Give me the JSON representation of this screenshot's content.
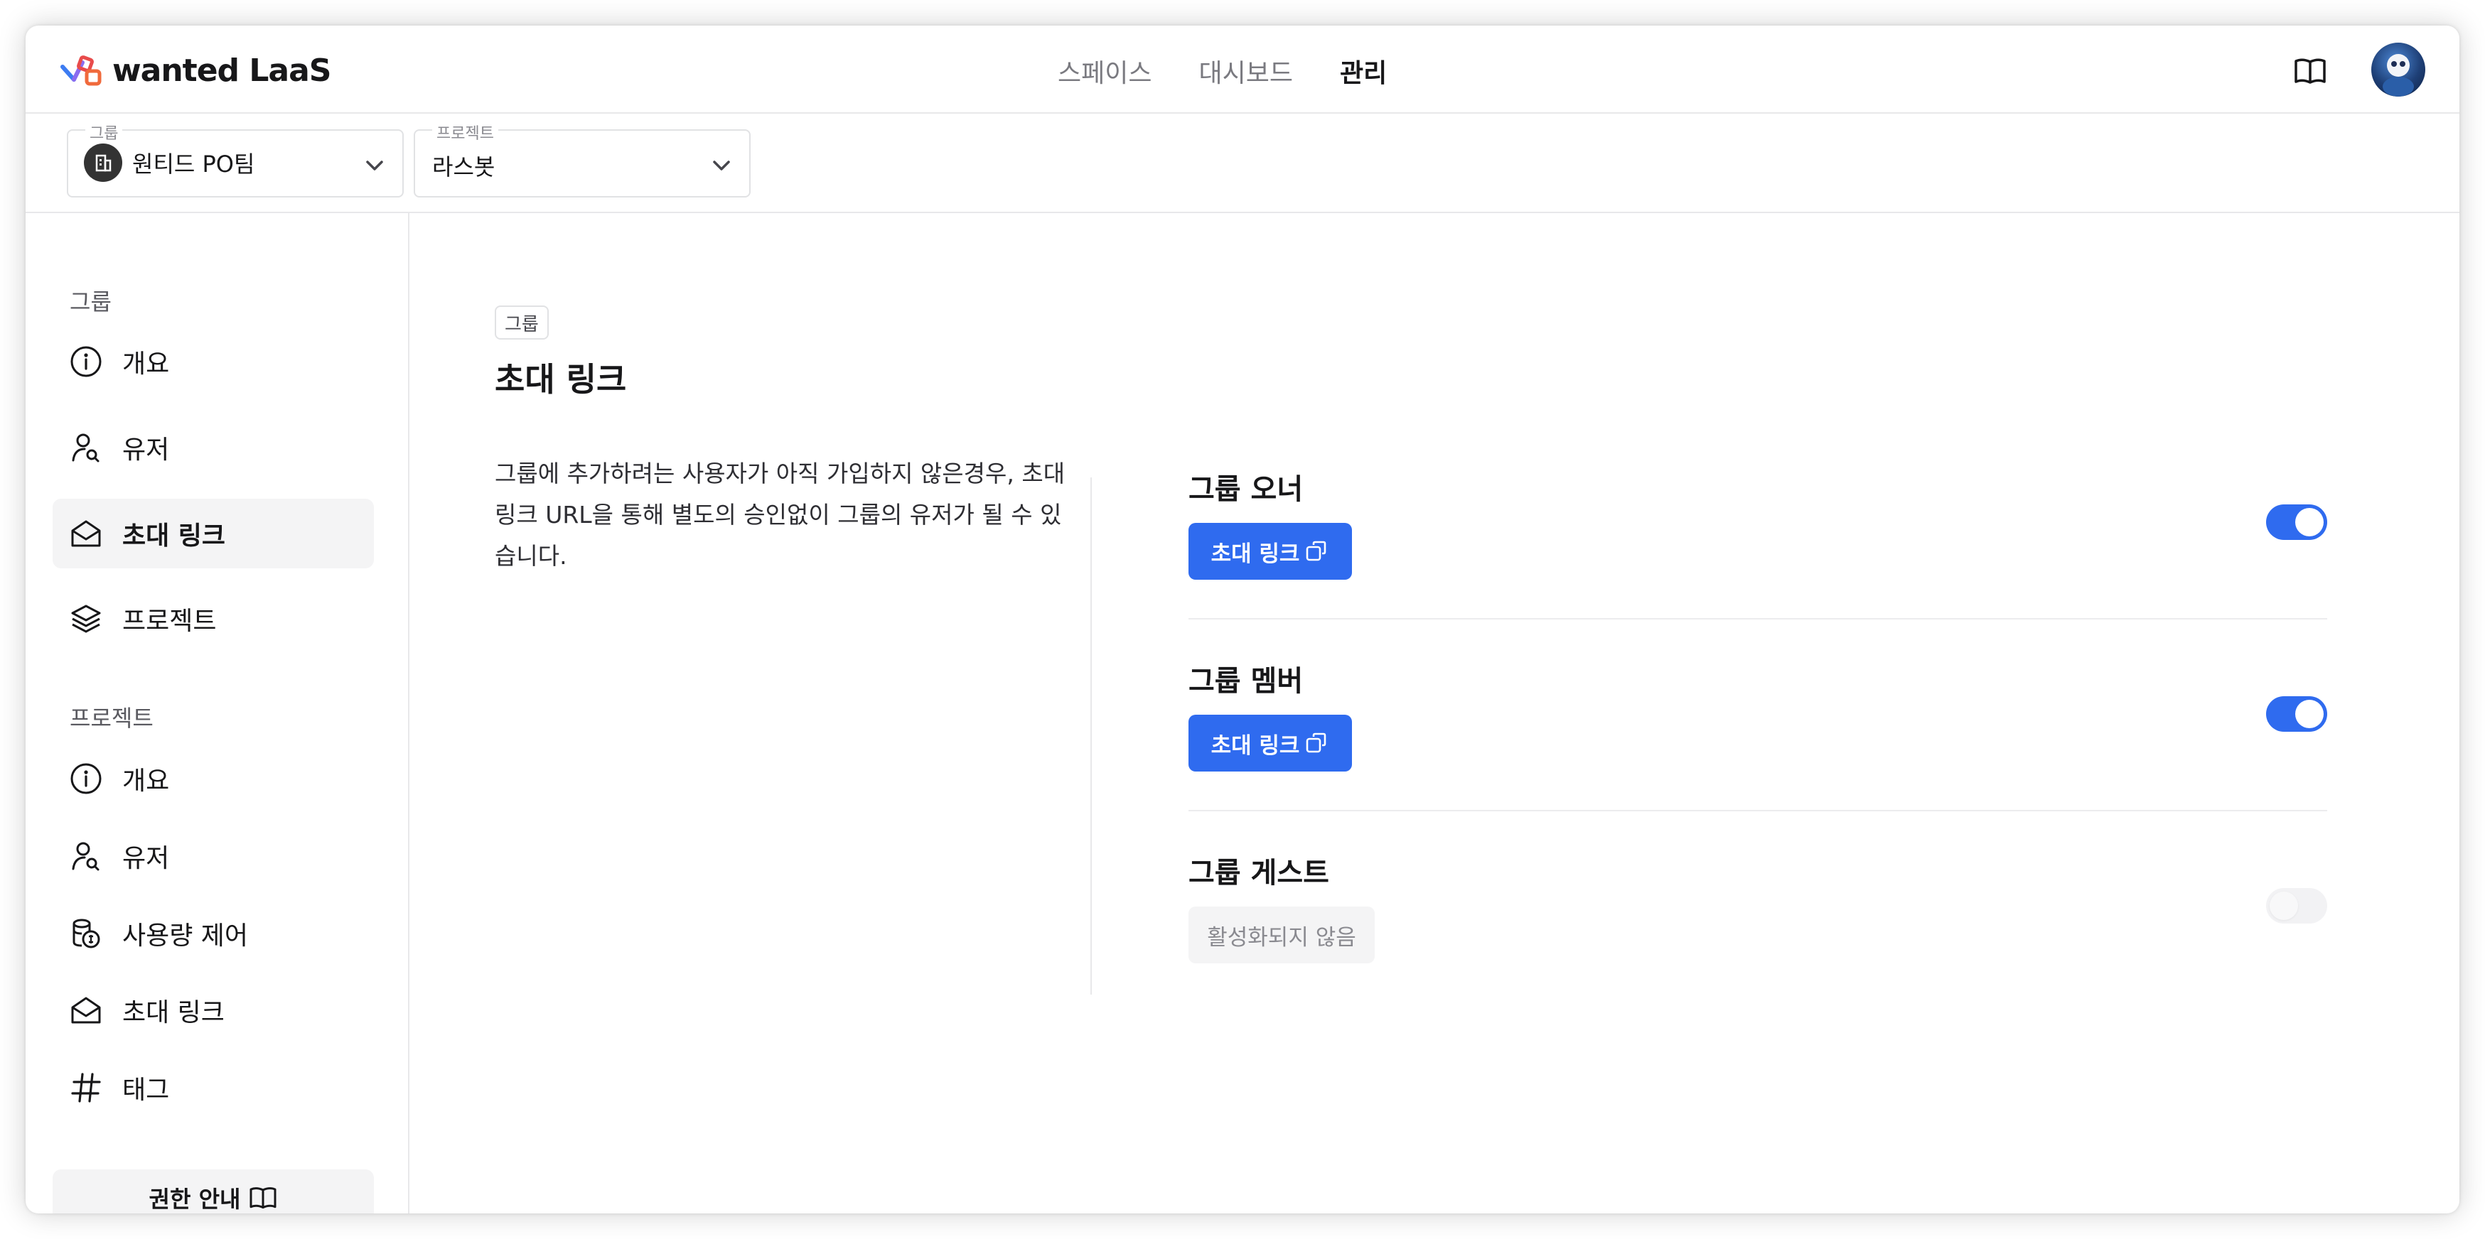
{
  "header": {
    "logo_text": "wanted LaaS",
    "nav": [
      {
        "label": "스페이스"
      },
      {
        "label": "대시보드"
      },
      {
        "label": "관리"
      }
    ],
    "active_nav": "관리"
  },
  "selectors": {
    "group": {
      "legend": "그룹",
      "value": "원티드 PO팀"
    },
    "project": {
      "legend": "프로젝트",
      "value": "라스봇"
    }
  },
  "sidebar": {
    "group_section": {
      "title": "그룹",
      "items": [
        {
          "label": "개요",
          "icon": "info-icon"
        },
        {
          "label": "유저",
          "icon": "user-search-icon"
        },
        {
          "label": "초대 링크",
          "icon": "envelope-open-icon"
        },
        {
          "label": "프로젝트",
          "icon": "layers-icon"
        }
      ]
    },
    "project_section": {
      "title": "프로젝트",
      "items": [
        {
          "label": "개요",
          "icon": "info-icon"
        },
        {
          "label": "유저",
          "icon": "user-search-icon"
        },
        {
          "label": "사용량 제어",
          "icon": "coins-icon"
        },
        {
          "label": "초대 링크",
          "icon": "envelope-open-icon"
        },
        {
          "label": "태그",
          "icon": "hash-icon"
        }
      ]
    },
    "permission_button": "권한 안내"
  },
  "main": {
    "tag": "그룹",
    "title": "초대 링크",
    "description": "그룹에 추가하려는 사용자가 아직 가입하지 않은경우, 초대 링크 URL을 통해 별도의 승인없이 그룹의 유저가 될 수 있습니다.",
    "roles": [
      {
        "title": "그룹 오너",
        "button": "초대 링크",
        "enabled": true
      },
      {
        "title": "그룹 멤버",
        "button": "초대 링크",
        "enabled": true
      },
      {
        "title": "그룹 게스트",
        "button": "활성화되지 않음",
        "enabled": false
      }
    ]
  },
  "colors": {
    "accent": "#2f6bef",
    "text": "#171719",
    "muted": "#7a7a80"
  }
}
